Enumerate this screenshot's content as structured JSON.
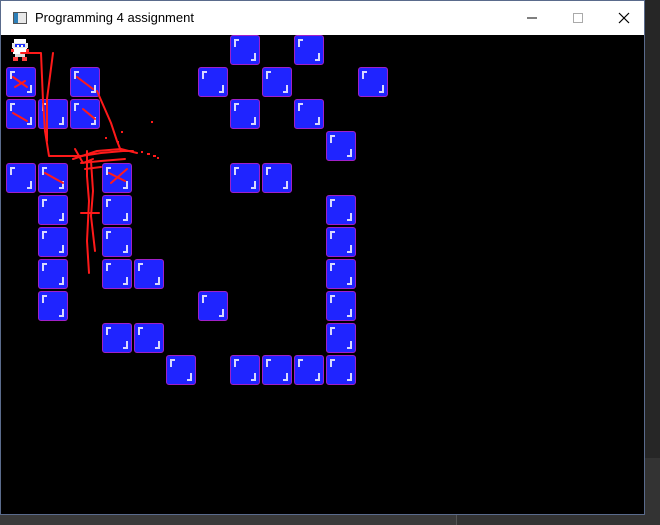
{
  "window": {
    "title": "Programming 4 assignment",
    "icon": "app-icon",
    "controls": [
      "minimize-icon",
      "maximize-icon",
      "close-icon"
    ]
  },
  "game": {
    "background": "#000000",
    "block_color": "#1f24ff",
    "block_border_color": "#a020c8",
    "debug_line_color": "#ff1a1a",
    "player_icon": "player-sprite-icon"
  }
}
